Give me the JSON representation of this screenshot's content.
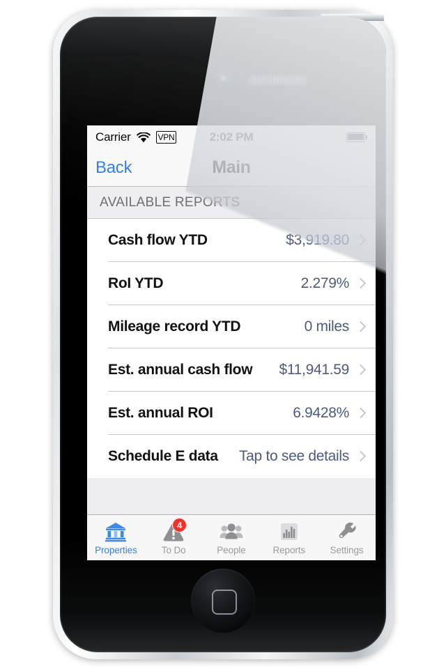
{
  "statusbar": {
    "carrier": "Carrier",
    "wifi_icon": "wifi-icon",
    "vpn": "VPN",
    "time": "2:02 PM",
    "battery_icon": "battery-full-icon"
  },
  "navbar": {
    "back_label": "Back",
    "title": "Main"
  },
  "section": {
    "header": "AVAILABLE REPORTS"
  },
  "rows": [
    {
      "label": "Cash flow YTD",
      "value": "$3,919.80",
      "chevron": "chevron-right-icon"
    },
    {
      "label": "RoI YTD",
      "value": "2.279%",
      "chevron": "chevron-right-icon"
    },
    {
      "label": "Mileage record YTD",
      "value": "0 miles",
      "chevron": "chevron-right-icon"
    },
    {
      "label": "Est. annual cash flow",
      "value": "$11,941.59",
      "chevron": "chevron-right-icon"
    },
    {
      "label": "Est. annual ROI",
      "value": "6.9428%",
      "chevron": "chevron-right-icon"
    },
    {
      "label": "Schedule E data",
      "value": "Tap to see details",
      "chevron": "chevron-right-icon"
    }
  ],
  "tabs": [
    {
      "label": "Properties",
      "icon": "bank-icon",
      "active": true,
      "badge": null
    },
    {
      "label": "To Do",
      "icon": "warning-triangle-icon",
      "active": false,
      "badge": "4"
    },
    {
      "label": "People",
      "icon": "people-icon",
      "active": false,
      "badge": null
    },
    {
      "label": "Reports",
      "icon": "bar-chart-icon",
      "active": false,
      "badge": null
    },
    {
      "label": "Settings",
      "icon": "wrench-icon",
      "active": false,
      "badge": null
    }
  ],
  "colors": {
    "accent_blue": "#2f7fef",
    "value_slate": "#4d5a79",
    "badge_red": "#f8302b",
    "section_header_gray": "#6d6d72",
    "tab_inactive_gray": "#9a9a9f",
    "separator": "#c8c7cc",
    "table_background": "#ededf2"
  }
}
